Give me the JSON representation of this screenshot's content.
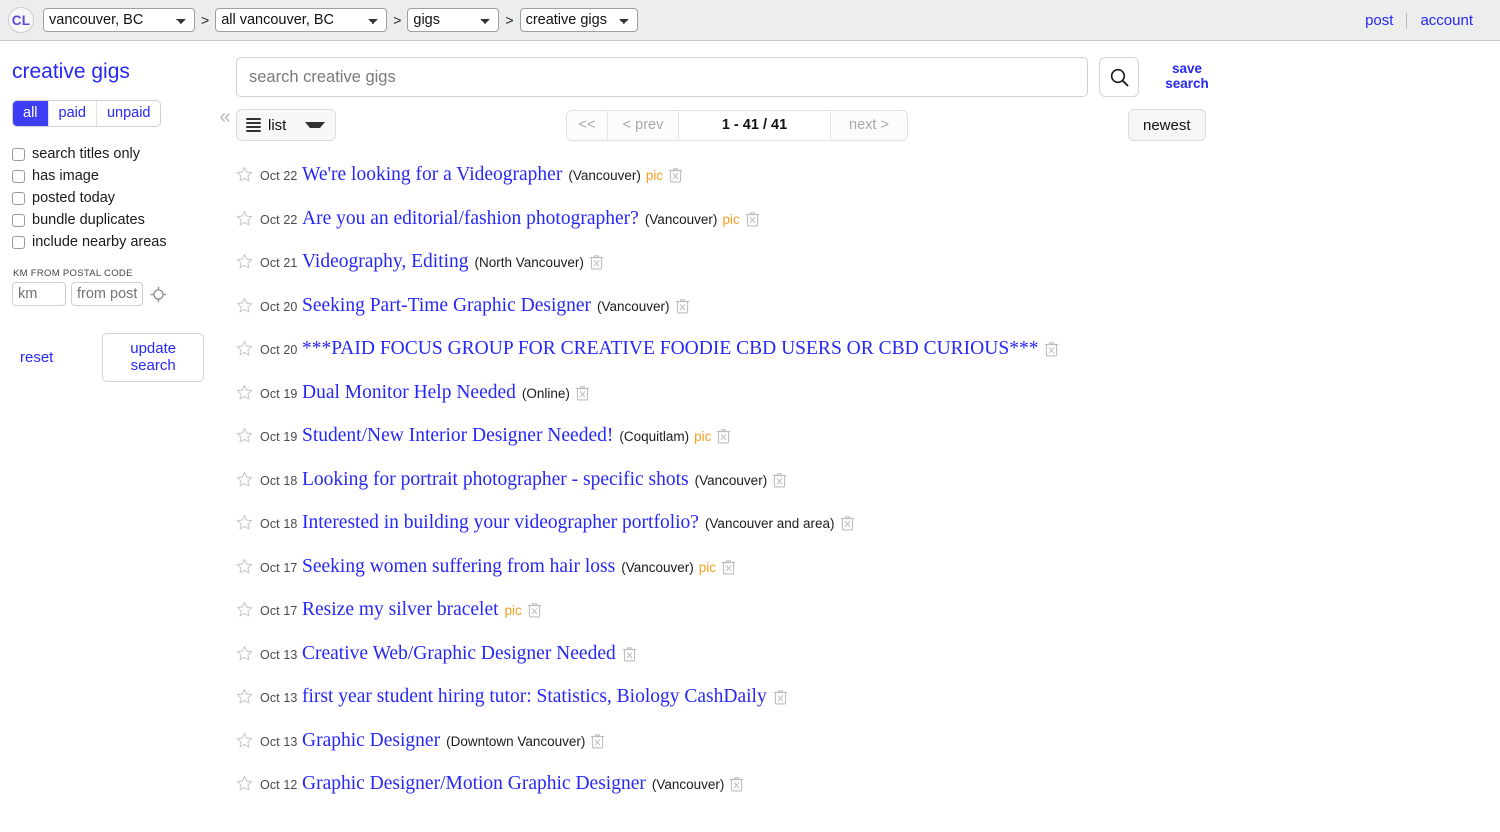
{
  "topbar": {
    "logo": "CL",
    "breadcrumbs": [
      {
        "name": "location-select",
        "value": "vancouver, BC"
      },
      {
        "name": "subarea-select",
        "value": "all vancouver, BC"
      },
      {
        "name": "category-select",
        "value": "gigs"
      },
      {
        "name": "subcategory-select",
        "value": "creative gigs"
      }
    ],
    "separator": ">",
    "post_label": "post",
    "account_label": "account"
  },
  "sidebar": {
    "title": "creative gigs",
    "segments": [
      {
        "label": "all",
        "active": true
      },
      {
        "label": "paid",
        "active": false
      },
      {
        "label": "unpaid",
        "active": false
      }
    ],
    "checkboxes": [
      {
        "label": "search titles only",
        "checked": false
      },
      {
        "label": "has image",
        "checked": false
      },
      {
        "label": "posted today",
        "checked": false
      },
      {
        "label": "bundle duplicates",
        "checked": false
      },
      {
        "label": "include nearby areas",
        "checked": false
      }
    ],
    "distance_label": "KM FROM POSTAL CODE",
    "distance_placeholder": "km",
    "distance_value": "",
    "postal_placeholder": "from postal code",
    "postal_value": "",
    "locate_icon": "crosshair-icon",
    "reset_label": "reset",
    "update_label": "update search"
  },
  "collapse": {
    "icon": "double-chevron-left-icon",
    "glyph": "«"
  },
  "search": {
    "placeholder": "search creative gigs",
    "value": "",
    "button_icon": "magnifier-icon",
    "save_label_line1": "save",
    "save_label_line2": "search"
  },
  "toolbar": {
    "view_icon": "list-lines-icon",
    "view_label": "list",
    "view_caret": "chevron-down-icon",
    "pager": {
      "first_label": "<<",
      "prev_label": "< prev",
      "count_label": "1 - 41 / 41",
      "next_label": "next >"
    },
    "sort_label": "newest"
  },
  "colors": {
    "link": "#2727f7",
    "accent_active": "#3d3df5",
    "pic_tag": "#f6a020",
    "topbar_bg": "#eceded"
  },
  "listings": [
    {
      "date": "Oct 22",
      "title": "We're looking for a Videographer",
      "hood": "(Vancouver)",
      "pic": "pic"
    },
    {
      "date": "Oct 22",
      "title": "Are you an editorial/fashion photographer?",
      "hood": "(Vancouver)",
      "pic": "pic"
    },
    {
      "date": "Oct 21",
      "title": "Videography, Editing",
      "hood": "(North Vancouver)",
      "pic": ""
    },
    {
      "date": "Oct 20",
      "title": "Seeking Part-Time Graphic Designer",
      "hood": "(Vancouver)",
      "pic": ""
    },
    {
      "date": "Oct 20",
      "title": "***PAID FOCUS GROUP FOR CREATIVE FOODIE CBD USERS OR CBD CURIOUS***",
      "hood": "",
      "pic": ""
    },
    {
      "date": "Oct 19",
      "title": "Dual Monitor Help Needed",
      "hood": "(Online)",
      "pic": ""
    },
    {
      "date": "Oct 19",
      "title": "Student/New Interior Designer Needed!",
      "hood": "(Coquitlam)",
      "pic": "pic"
    },
    {
      "date": "Oct 18",
      "title": "Looking for portrait photographer - specific shots",
      "hood": "(Vancouver)",
      "pic": ""
    },
    {
      "date": "Oct 18",
      "title": "Interested in building your videographer portfolio?",
      "hood": "(Vancouver and area)",
      "pic": ""
    },
    {
      "date": "Oct 17",
      "title": "Seeking women suffering from hair loss",
      "hood": "(Vancouver)",
      "pic": "pic"
    },
    {
      "date": "Oct 17",
      "title": "Resize my silver bracelet",
      "hood": "",
      "pic": "pic"
    },
    {
      "date": "Oct 13",
      "title": "Creative Web/Graphic Designer Needed",
      "hood": "",
      "pic": ""
    },
    {
      "date": "Oct 13",
      "title": "first year student hiring tutor: Statistics, Biology CashDaily",
      "hood": "",
      "pic": ""
    },
    {
      "date": "Oct 13",
      "title": "Graphic Designer",
      "hood": "(Downtown Vancouver)",
      "pic": ""
    },
    {
      "date": "Oct 12",
      "title": "Graphic Designer/Motion Graphic Designer",
      "hood": "(Vancouver)",
      "pic": ""
    }
  ]
}
